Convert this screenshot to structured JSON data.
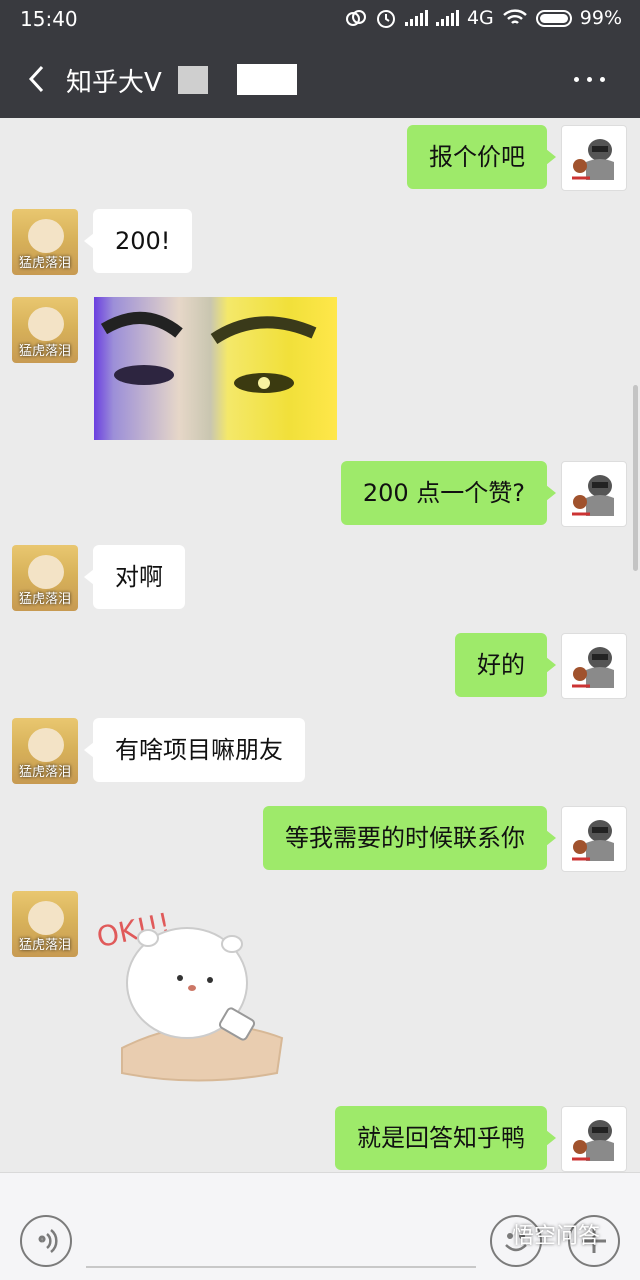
{
  "status_bar": {
    "time": "15:40",
    "network": "4G",
    "battery": "99%"
  },
  "header": {
    "title": "知乎大V"
  },
  "messages": [
    {
      "side": "out",
      "text": "报个价吧"
    },
    {
      "side": "in",
      "text": "200!"
    },
    {
      "side": "in",
      "type": "image"
    },
    {
      "side": "out",
      "text": "200 点一个赞?"
    },
    {
      "side": "in",
      "text": "对啊"
    },
    {
      "side": "out",
      "text": "好的"
    },
    {
      "side": "in",
      "text": "有啥项目嘛朋友"
    },
    {
      "side": "out",
      "text": "等我需要的时候联系你"
    },
    {
      "side": "in",
      "type": "sticker",
      "sticker_text": "OK!!!"
    },
    {
      "side": "out",
      "text": "就是回答知乎鸭"
    }
  ],
  "contact": {
    "avatar_caption": "猛虎落泪"
  },
  "watermark": "悟空问答",
  "icons": [
    "back-arrow-icon",
    "more-dots-icon",
    "voice-icon",
    "emoji-icon",
    "plus-icon"
  ]
}
